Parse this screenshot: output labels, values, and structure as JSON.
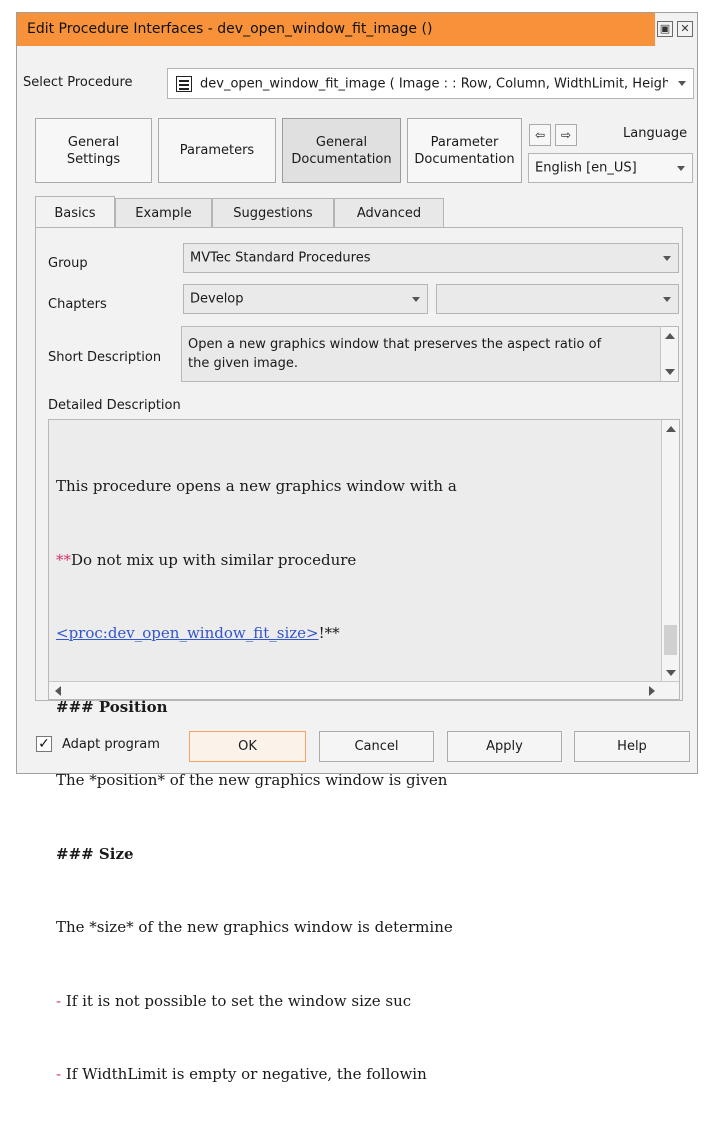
{
  "window": {
    "title": "Edit Procedure Interfaces - dev_open_window_fit_image ()",
    "restore_icon": "restore-icon",
    "close_icon": "close-icon",
    "accent_color": "#f7913a"
  },
  "select_procedure": {
    "label": "Select Procedure",
    "value": "dev_open_window_fit_image ( Image : : Row, Column, WidthLimit, HeightLimit : WindowHandle )"
  },
  "nav_buttons": [
    {
      "label": "General Settings"
    },
    {
      "label": "Parameters"
    },
    {
      "label": "General Documentation"
    },
    {
      "label": "Parameter Documentation"
    }
  ],
  "history": {
    "back_icon": "arrow-left-icon",
    "forward_icon": "arrow-right-icon"
  },
  "language": {
    "label": "Language",
    "value": "English [en_US]"
  },
  "tabs": [
    {
      "label": "Basics"
    },
    {
      "label": "Example"
    },
    {
      "label": "Suggestions"
    },
    {
      "label": "Advanced"
    }
  ],
  "basics": {
    "group_label": "Group",
    "group_value": "MVTec Standard Procedures",
    "chapters_label": "Chapters",
    "chapter_value": "Develop",
    "subchapter_value": "",
    "short_description_label": "Short Description",
    "short_description_line1": "Open a new graphics window that preserves the aspect ratio of",
    "short_description_line2": "the given image.",
    "detailed_description_label": "Detailed Description",
    "detailed_lines": [
      {
        "pre": "",
        "text": "This procedure opens a new graphics window with a"
      },
      {
        "pre": "**",
        "text": "Do not mix up with similar procedure"
      },
      {
        "pre": "",
        "link": "<proc:dev_open_window_fit_size>",
        "post": "!**"
      },
      {
        "pre": "",
        "bold": "### Position"
      },
      {
        "pre": "",
        "text": "The *position* of the new graphics window is given"
      },
      {
        "pre": "",
        "bold": "### Size"
      },
      {
        "pre": "",
        "text": "The *size* of the new graphics window is determine"
      },
      {
        "pre": "- ",
        "text": "If it is not possible to set the window size suc"
      },
      {
        "pre": "- ",
        "text": "If WidthLimit is empty or negative, the followin"
      }
    ]
  },
  "footer": {
    "adapt_program_label": "Adapt program",
    "adapt_program_checked": true,
    "ok_label": "OK",
    "cancel_label": "Cancel",
    "apply_label": "Apply",
    "help_label": "Help"
  }
}
